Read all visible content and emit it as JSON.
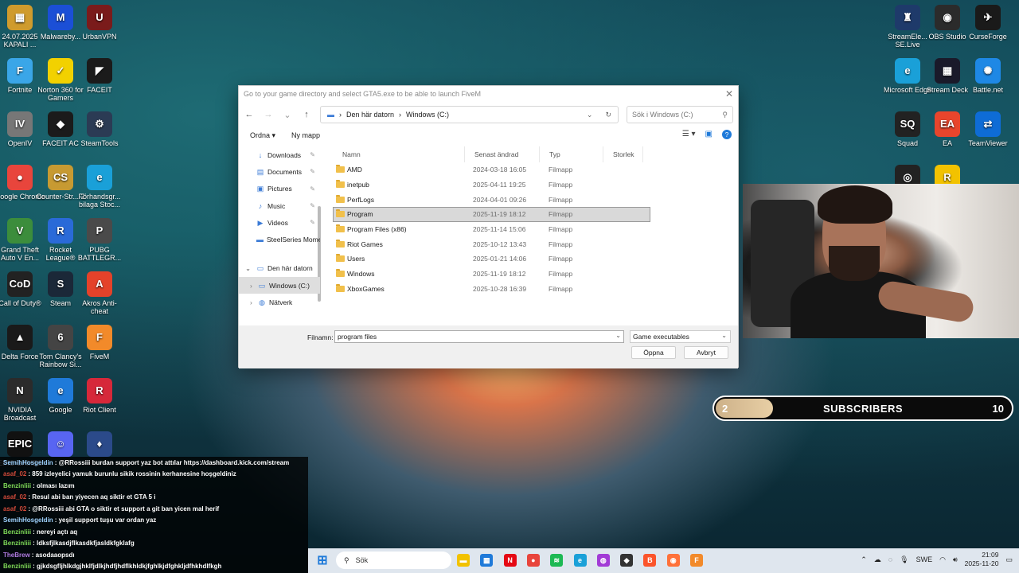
{
  "desktop": {
    "left_icons": [
      {
        "label": "24.07.2025 KAPALI ...",
        "color": "#cf9b2d",
        "glyph": "▦"
      },
      {
        "label": "Malwareby...",
        "color": "#1b4fd6",
        "glyph": "M"
      },
      {
        "label": "UrbanVPN",
        "color": "#7a1b1b",
        "glyph": "U"
      },
      {
        "label": "Fortnite",
        "color": "#3aa6e8",
        "glyph": "F"
      },
      {
        "label": "Norton 360 for Gamers",
        "color": "#f2d100",
        "glyph": "✓"
      },
      {
        "label": "FACEIT",
        "color": "#1b1b1b",
        "glyph": "◤"
      },
      {
        "label": "OpenIV",
        "color": "#777777",
        "glyph": "IV"
      },
      {
        "label": "FACEIT AC",
        "color": "#1b1b1b",
        "glyph": "◆"
      },
      {
        "label": "SteamTools",
        "color": "#2b3b54",
        "glyph": "⚙"
      },
      {
        "label": "Google Chrome",
        "color": "#e8453c",
        "glyph": "●"
      },
      {
        "label": "Counter-Str... 2",
        "color": "#c79a32",
        "glyph": "CS"
      },
      {
        "label": "Förhandsgr... bilaga Stoc...",
        "color": "#1aa0d8",
        "glyph": "e"
      },
      {
        "label": "Grand Theft Auto V En...",
        "color": "#3c8d3c",
        "glyph": "V"
      },
      {
        "label": "Rocket League®",
        "color": "#2a6ad8",
        "glyph": "R"
      },
      {
        "label": "PUBG BATTLEGR...",
        "color": "#4a4a4a",
        "glyph": "P"
      },
      {
        "label": "Call of Duty®",
        "color": "#222222",
        "glyph": "CoD"
      },
      {
        "label": "Steam",
        "color": "#1b2838",
        "glyph": "S"
      },
      {
        "label": "Akros Anti-cheat",
        "color": "#e4422a",
        "glyph": "A"
      },
      {
        "label": "Delta Force",
        "color": "#1a1a1a",
        "glyph": "▲"
      },
      {
        "label": "Tom Clancy's Rainbow Si...",
        "color": "#444444",
        "glyph": "6"
      },
      {
        "label": "FiveM",
        "color": "#f28a2a",
        "glyph": "F"
      },
      {
        "label": "NVIDIA Broadcast",
        "color": "#2b2b2b",
        "glyph": "N"
      },
      {
        "label": "Google",
        "color": "#1f7ad9",
        "glyph": "e"
      },
      {
        "label": "Riot Client",
        "color": "#d6283a",
        "glyph": "R"
      },
      {
        "label": "EPIC GAMES",
        "color": "#111111",
        "glyph": "EPIC"
      },
      {
        "label": "",
        "color": "#5865f2",
        "glyph": "☺"
      },
      {
        "label": "",
        "color": "#2b4a8a",
        "glyph": "♦"
      }
    ],
    "right_icons": [
      {
        "label": "StreamEle... SE.Live",
        "color": "#1e3a6a",
        "glyph": "♜"
      },
      {
        "label": "OBS Studio",
        "color": "#2b2b2b",
        "glyph": "◉"
      },
      {
        "label": "CurseForge",
        "color": "#1a1a1a",
        "glyph": "✈"
      },
      {
        "label": "Microsoft Edge",
        "color": "#1aa0d8",
        "glyph": "e"
      },
      {
        "label": "Stream Deck",
        "color": "#1a1a2a",
        "glyph": "▦"
      },
      {
        "label": "Battle.net",
        "color": "#1e88e5",
        "glyph": "✺"
      },
      {
        "label": "Squad",
        "color": "#222222",
        "glyph": "SQ"
      },
      {
        "label": "EA",
        "color": "#e8452c",
        "glyph": "EA"
      },
      {
        "label": "TeamViewer",
        "color": "#0e6cd6",
        "glyph": "⇄"
      },
      {
        "label": "",
        "color": "#222222",
        "glyph": "◎"
      },
      {
        "label": "",
        "color": "#f2c200",
        "glyph": "R"
      }
    ]
  },
  "dialog": {
    "title": "Go to your game directory and select GTA5.exe to be able to launch FiveM",
    "breadcrumb": [
      "Den här datorn",
      "Windows (C:)"
    ],
    "search_placeholder": "Sök i Windows (C:)",
    "toolbar": {
      "organize": "Ordna",
      "new_folder": "Ny mapp"
    },
    "sidebar": [
      {
        "label": "Downloads",
        "icon": "↓",
        "pinned": true
      },
      {
        "label": "Documents",
        "icon": "▤",
        "pinned": true
      },
      {
        "label": "Pictures",
        "icon": "▣",
        "pinned": true
      },
      {
        "label": "Music",
        "icon": "♪",
        "pinned": true
      },
      {
        "label": "Videos",
        "icon": "▶",
        "pinned": true
      },
      {
        "label": "SteelSeries Moments",
        "icon": "▬",
        "pinned": false
      },
      {
        "label": "Den här datorn",
        "icon": "▭",
        "pinned": false
      },
      {
        "label": "Windows (C:)",
        "icon": "▭",
        "pinned": false
      },
      {
        "label": "Nätverk",
        "icon": "◍",
        "pinned": false
      }
    ],
    "columns": [
      "Namn",
      "Senast ändrad",
      "Typ",
      "Storlek"
    ],
    "files": [
      {
        "name": "AMD",
        "date": "2024-03-18 16:05",
        "type": "Filmapp"
      },
      {
        "name": "inetpub",
        "date": "2025-04-11 19:25",
        "type": "Filmapp"
      },
      {
        "name": "PerfLogs",
        "date": "2024-04-01 09:26",
        "type": "Filmapp"
      },
      {
        "name": "Program",
        "date": "2025-11-19 18:12",
        "type": "Filmapp"
      },
      {
        "name": "Program Files (x86)",
        "date": "2025-11-14 15:06",
        "type": "Filmapp"
      },
      {
        "name": "Riot Games",
        "date": "2025-10-12 13:43",
        "type": "Filmapp"
      },
      {
        "name": "Users",
        "date": "2025-01-21 14:06",
        "type": "Filmapp"
      },
      {
        "name": "Windows",
        "date": "2025-11-19 18:12",
        "type": "Filmapp"
      },
      {
        "name": "XboxGames",
        "date": "2025-10-28 16:39",
        "type": "Filmapp"
      }
    ],
    "filename_label": "Filnamn:",
    "filename_value": "program files",
    "filetype": "Game executables",
    "open_label": "Öppna",
    "cancel_label": "Avbryt"
  },
  "subs_widget": {
    "current": "2",
    "label": "SUBSCRIBERS",
    "goal": "10",
    "progress": 0.2
  },
  "chat": [
    {
      "user": "SemihHosgeldin",
      "color": "#9fd3ff",
      "msg": ": @RRossiii burdan support yaz bot attılar https://dashboard.kick.com/stream"
    },
    {
      "user": "asaf_02",
      "color": "#d04a3a",
      "msg": ": 859 izleyelici yamuk burunlu sikik rossinin kerhanesine hoşgeldiniz"
    },
    {
      "user": "Benzinliii",
      "color": "#7ed957",
      "msg": ": olması lazım"
    },
    {
      "user": "asaf_02",
      "color": "#d04a3a",
      "msg": ": Resul abi ban yiyecen aq siktir et GTA 5 i"
    },
    {
      "user": "asaf_02",
      "color": "#d04a3a",
      "msg": ": @RRossiii abi GTA o siktir et support a git ban yicen mal herif"
    },
    {
      "user": "SemihHosgeldin",
      "color": "#9fd3ff",
      "msg": ": yeşil support tuşu var ordan yaz"
    },
    {
      "user": "Benzinliii",
      "color": "#7ed957",
      "msg": ": nereyi açtı aq"
    },
    {
      "user": "Benzinliii",
      "color": "#7ed957",
      "msg": ": ldksfjlkasdjflkasdkfjasldkfgklafg"
    },
    {
      "user": "TheBrew",
      "color": "#b07be0",
      "msg": ": asodaaopsdı"
    },
    {
      "user": "Benzinliii",
      "color": "#7ed957",
      "msg": ": gjkdsgfljhlkdgjhklfjdlkjhdfjhdflkhldkjfghlkjdfghkljdfhkhdlfkgh"
    }
  ],
  "taskbar": {
    "search_placeholder": "Sök",
    "apps": [
      {
        "name": "file-explorer",
        "color": "#f2c200",
        "glyph": "▬"
      },
      {
        "name": "store",
        "color": "#1f7ad9",
        "glyph": "▦"
      },
      {
        "name": "netflix",
        "color": "#e50914",
        "glyph": "N"
      },
      {
        "name": "chrome",
        "color": "#e8453c",
        "glyph": "●"
      },
      {
        "name": "spotify",
        "color": "#1db954",
        "glyph": "≋"
      },
      {
        "name": "edge",
        "color": "#1aa0d8",
        "glyph": "e"
      },
      {
        "name": "messenger",
        "color": "#a23bd6",
        "glyph": "◍"
      },
      {
        "name": "app",
        "color": "#333333",
        "glyph": "◆"
      },
      {
        "name": "brave",
        "color": "#fb542b",
        "glyph": "B"
      },
      {
        "name": "firefox",
        "color": "#ff7139",
        "glyph": "◉"
      },
      {
        "name": "fivem",
        "color": "#f28a2a",
        "glyph": "F"
      }
    ],
    "lang": "SWE",
    "time": "21:09",
    "date": "2025-11-20"
  }
}
